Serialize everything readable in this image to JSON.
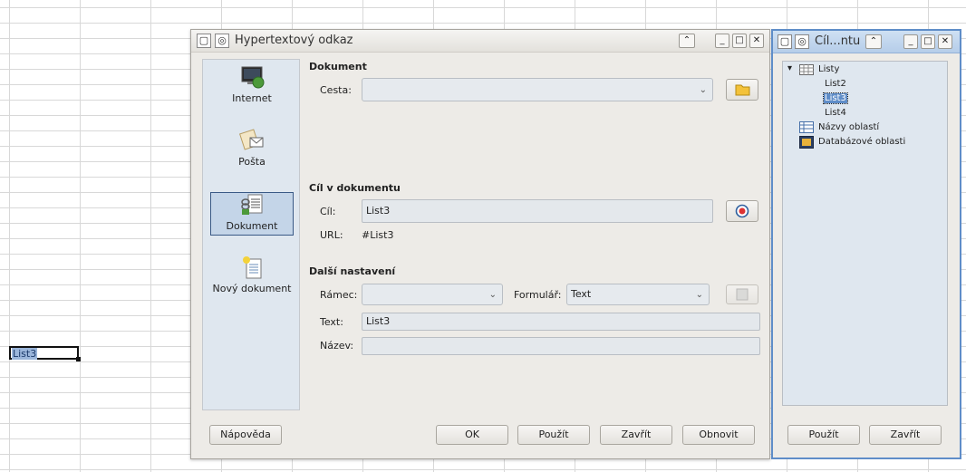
{
  "spreadsheet": {
    "selected_cell_text": "List3"
  },
  "dialog": {
    "title": "Hypertextový odkaz",
    "sidebar": [
      {
        "label": "Internet",
        "icon": "internet-icon"
      },
      {
        "label": "Pošta",
        "icon": "mail-icon"
      },
      {
        "label": "Dokument",
        "icon": "document-link-icon",
        "active": true
      },
      {
        "label": "Nový dokument",
        "icon": "new-document-icon"
      }
    ],
    "document_section": {
      "title": "Dokument",
      "path_label": "Cesta:",
      "path_value": ""
    },
    "target_section": {
      "title": "Cíl v dokumentu",
      "target_label": "Cíl:",
      "target_value": "List3",
      "url_label": "URL:",
      "url_value": "#List3"
    },
    "more_section": {
      "title": "Další nastavení",
      "frame_label": "Rámec:",
      "frame_value": "",
      "form_label": "Formulář:",
      "form_value": "Text",
      "text_label": "Text:",
      "text_value": "List3",
      "name_label": "Název:",
      "name_value": ""
    },
    "buttons": {
      "help": "Nápověda",
      "ok": "OK",
      "apply": "Použít",
      "close": "Zavřít",
      "reset": "Obnovit"
    }
  },
  "navigator": {
    "title": "Cíl...ntu",
    "tree": {
      "sheets_label": "Listy",
      "sheets": [
        "List2",
        "List3",
        "List4"
      ],
      "selected": "List3",
      "range_names_label": "Názvy oblastí",
      "db_ranges_label": "Databázové oblasti"
    },
    "buttons": {
      "apply": "Použít",
      "close": "Zavřít"
    }
  },
  "colors": {
    "accent": "#5f8dc8",
    "selection": "#c4d5e8",
    "panel": "#dfe7ef"
  }
}
